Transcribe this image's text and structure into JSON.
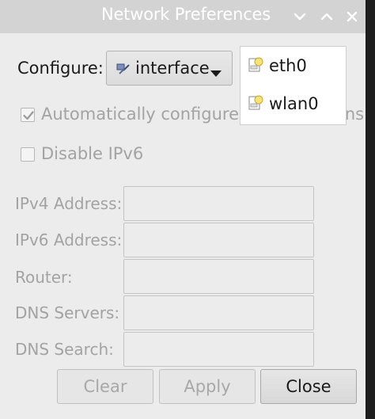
{
  "window": {
    "title": "Network Preferences",
    "controls": [
      "chevron-down-icon",
      "chevron-up-icon",
      "close-icon"
    ]
  },
  "configure": {
    "label": "Configure:",
    "selected": "interface",
    "icon": "network-interface-icon"
  },
  "dropdown": {
    "items": [
      {
        "label": "eth0",
        "icon": "network-adapter-icon"
      },
      {
        "label": "wlan0",
        "icon": "network-adapter-icon"
      }
    ]
  },
  "options": {
    "auto_configure": {
      "label": "Automatically configure empty options",
      "checked": true,
      "enabled": false
    },
    "disable_ipv6": {
      "label": "Disable IPv6",
      "checked": false,
      "enabled": false
    }
  },
  "fields": [
    {
      "label": "IPv4 Address:",
      "value": ""
    },
    {
      "label": "IPv6 Address:",
      "value": ""
    },
    {
      "label": "Router:",
      "value": ""
    },
    {
      "label": "DNS Servers:",
      "value": ""
    },
    {
      "label": "DNS Search:",
      "value": ""
    }
  ],
  "buttons": {
    "clear": "Clear",
    "apply": "Apply",
    "close": "Close"
  },
  "colors": {
    "titlebar": "#d3d3d3",
    "window_bg": "#ececec",
    "disabled_text": "#a3a3a3"
  }
}
